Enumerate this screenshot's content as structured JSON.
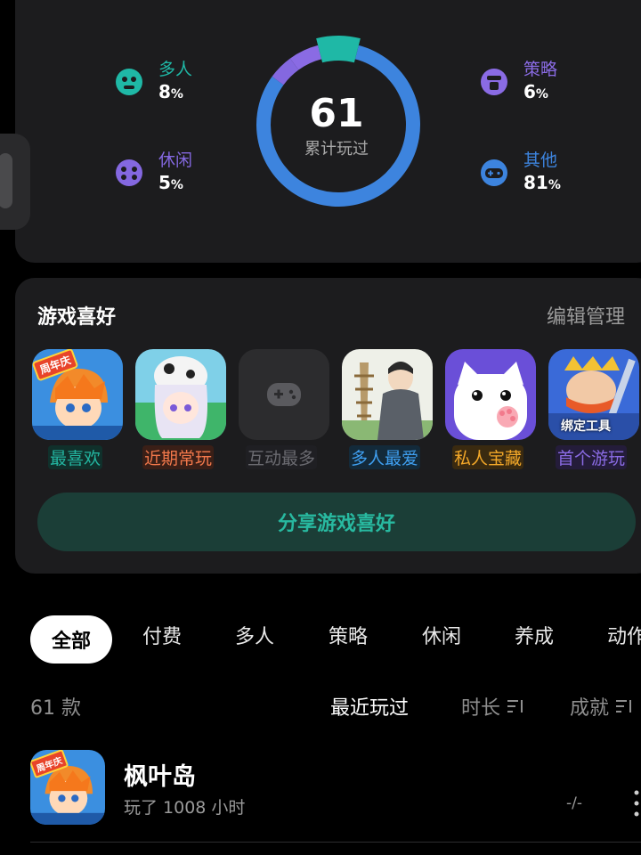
{
  "stats": {
    "total": "61",
    "total_label": "累计玩过",
    "categories": [
      {
        "label": "多人",
        "pct": "8",
        "value": 8,
        "color": "#1fb8a6",
        "icon": "multiplayer-icon"
      },
      {
        "label": "休闲",
        "pct": "5",
        "value": 5,
        "color": "#8468e0",
        "icon": "casual-icon"
      },
      {
        "label": "策略",
        "pct": "6",
        "value": 6,
        "color": "#8a6be4",
        "icon": "strategy-icon"
      },
      {
        "label": "其他",
        "pct": "81",
        "value": 81,
        "color": "#3d84de",
        "icon": "gamepad-icon"
      }
    ],
    "pct_unit": "%"
  },
  "preferences": {
    "title": "游戏喜好",
    "edit_label": "编辑管理",
    "games": [
      {
        "label": "最喜欢",
        "color": "#23b5a0"
      },
      {
        "label": "近期常玩",
        "color": "#f2784b"
      },
      {
        "label": "互动最多",
        "color": "#6a6a70"
      },
      {
        "label": "多人最爱",
        "color": "#3f9ff0"
      },
      {
        "label": "私人宝藏",
        "color": "#f3a829"
      },
      {
        "label": "首个游玩",
        "color": "#8a6be4"
      }
    ],
    "game1_badge": "周年庆",
    "game6_badge": "绑定工具",
    "share_label": "分享游戏喜好"
  },
  "filters": {
    "chips": [
      "全部",
      "付费",
      "多人",
      "策略",
      "休闲",
      "养成",
      "动作"
    ]
  },
  "list_header": {
    "count": "61 款",
    "sort_recent": "最近玩过",
    "sort_duration": "时长",
    "sort_achievement": "成就"
  },
  "games_list": [
    {
      "name": "枫叶岛",
      "playtime": "玩了 1008 小时",
      "score": "-/-",
      "badge": "周年庆"
    }
  ]
}
